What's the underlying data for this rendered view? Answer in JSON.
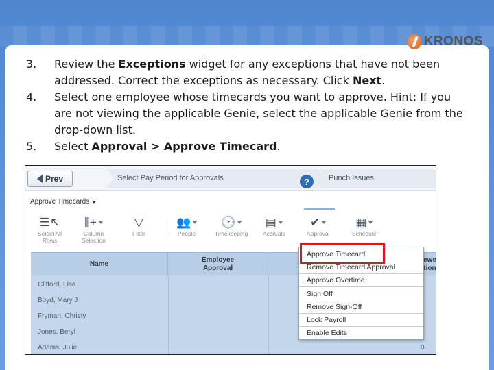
{
  "logo": {
    "text": "KRONOS"
  },
  "instructions": [
    {
      "num": "3.",
      "parts": [
        "Review the ",
        "Exceptions",
        " widget for any exceptions that have not been addressed. Correct the exceptions as necessary. Click ",
        "Next",
        "."
      ]
    },
    {
      "num": "4.",
      "text": "Select one employee whose timecards you want to approve. Hint: If you are not viewing the applicable Genie, select the applicable Genie from the drop-down list."
    },
    {
      "num": "5.",
      "parts": [
        "Select ",
        "Approval > Approve Timecard",
        "."
      ]
    }
  ],
  "wizard": {
    "prev_label": "Prev",
    "steps": [
      "Select Pay Period for Approvals",
      "Punch Issues"
    ]
  },
  "view_select": {
    "value": "Approve Timecards"
  },
  "toolbar": {
    "select_all": "Select All\nRows",
    "column_selection": "Column\nSelection",
    "filter": "Filter",
    "people": "People",
    "timekeeping": "Timekeeping",
    "accruals": "Accruals",
    "approval": "Approval",
    "schedule": "Schedule"
  },
  "grid": {
    "columns": [
      "Name",
      "Employee\nApproval",
      "ewe\ntion"
    ],
    "rows": [
      {
        "name": "Clifford, Lisa",
        "value": ""
      },
      {
        "name": "Boyd, Mary J",
        "value": ""
      },
      {
        "name": "Fryman, Christy",
        "value": ""
      },
      {
        "name": "Jones, Beryl",
        "value": ""
      },
      {
        "name": "Adams, Julie",
        "value": "0"
      }
    ]
  },
  "approval_menu": {
    "items": [
      "Approve Timecard",
      "Remove Timecard Approval",
      "Approve Overtime",
      "Sign Off",
      "Remove Sign-Off",
      "Lock Payroll",
      "Enable Edits"
    ]
  },
  "colors": {
    "highlight": "#e0141b",
    "grid_header": "#b8cde6",
    "slide_bg": "#5b8fd6"
  }
}
